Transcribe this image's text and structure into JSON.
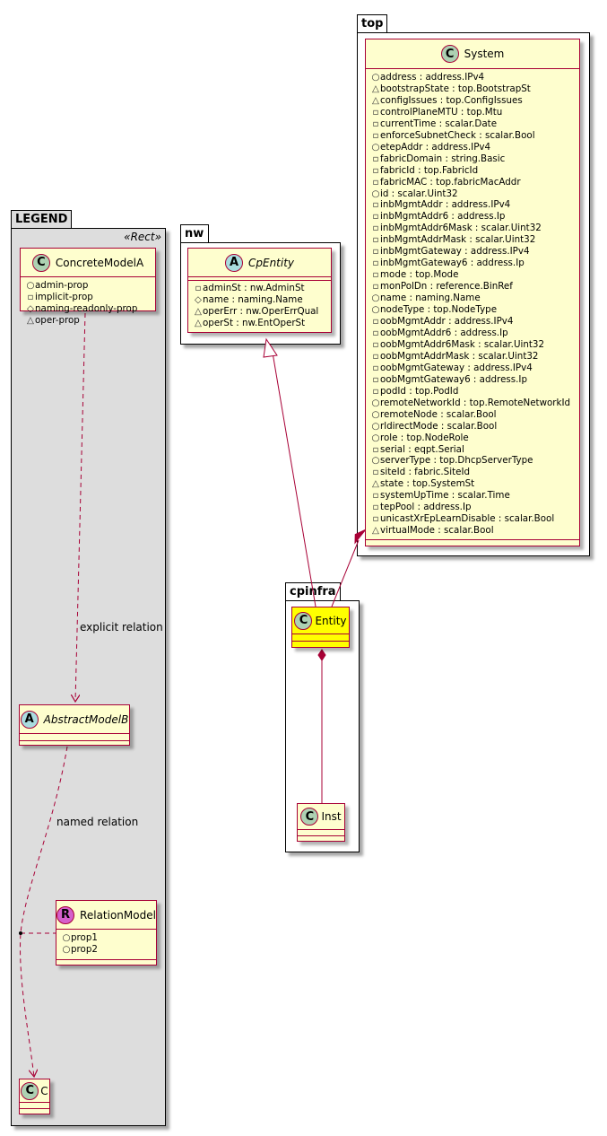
{
  "packages": {
    "legend": {
      "name": "LEGEND",
      "stereotype": "«Rect»"
    },
    "nw": {
      "name": "nw"
    },
    "top": {
      "name": "top"
    },
    "cpinfra": {
      "name": "cpinfra"
    }
  },
  "classes": {
    "concrete_model_a": {
      "kind": "C",
      "name": "ConcreteModelA",
      "attrs": [
        {
          "vis": "○",
          "text": "admin-prop"
        },
        {
          "vis": "▫",
          "text": "implicit-prop"
        },
        {
          "vis": "◇",
          "text": "naming-readonly-prop"
        },
        {
          "vis": "△",
          "text": "oper-prop"
        }
      ]
    },
    "abstract_model_b": {
      "kind": "A",
      "name": "AbstractModelB"
    },
    "relation_model": {
      "kind": "R",
      "name": "RelationModel",
      "attrs": [
        {
          "vis": "○",
          "text": "prop1"
        },
        {
          "vis": "○",
          "text": "prop2"
        }
      ]
    },
    "c": {
      "kind": "C",
      "name": "C"
    },
    "cp_entity": {
      "kind": "A",
      "name": "CpEntity",
      "attrs": [
        {
          "vis": "▫",
          "text": "adminSt : nw.AdminSt"
        },
        {
          "vis": "◇",
          "text": "name : naming.Name"
        },
        {
          "vis": "△",
          "text": "operErr : nw.OperErrQual"
        },
        {
          "vis": "△",
          "text": "operSt : nw.EntOperSt"
        }
      ]
    },
    "system": {
      "kind": "C",
      "name": "System",
      "attrs": [
        {
          "vis": "○",
          "text": "address : address.IPv4"
        },
        {
          "vis": "△",
          "text": "bootstrapState : top.BootstrapSt"
        },
        {
          "vis": "△",
          "text": "configIssues : top.ConfigIssues"
        },
        {
          "vis": "▫",
          "text": "controlPlaneMTU : top.Mtu"
        },
        {
          "vis": "▫",
          "text": "currentTime : scalar.Date"
        },
        {
          "vis": "▫",
          "text": "enforceSubnetCheck : scalar.Bool"
        },
        {
          "vis": "○",
          "text": "etepAddr : address.IPv4"
        },
        {
          "vis": "▫",
          "text": "fabricDomain : string.Basic"
        },
        {
          "vis": "▫",
          "text": "fabricId : top.FabricId"
        },
        {
          "vis": "▫",
          "text": "fabricMAC : top.fabricMacAddr"
        },
        {
          "vis": "○",
          "text": "id : scalar.Uint32"
        },
        {
          "vis": "▫",
          "text": "inbMgmtAddr : address.IPv4"
        },
        {
          "vis": "▫",
          "text": "inbMgmtAddr6 : address.Ip"
        },
        {
          "vis": "▫",
          "text": "inbMgmtAddr6Mask : scalar.Uint32"
        },
        {
          "vis": "▫",
          "text": "inbMgmtAddrMask : scalar.Uint32"
        },
        {
          "vis": "▫",
          "text": "inbMgmtGateway : address.IPv4"
        },
        {
          "vis": "▫",
          "text": "inbMgmtGateway6 : address.Ip"
        },
        {
          "vis": "▫",
          "text": "mode : top.Mode"
        },
        {
          "vis": "▫",
          "text": "monPolDn : reference.BinRef"
        },
        {
          "vis": "○",
          "text": "name : naming.Name"
        },
        {
          "vis": "○",
          "text": "nodeType : top.NodeType"
        },
        {
          "vis": "▫",
          "text": "oobMgmtAddr : address.IPv4"
        },
        {
          "vis": "▫",
          "text": "oobMgmtAddr6 : address.Ip"
        },
        {
          "vis": "▫",
          "text": "oobMgmtAddr6Mask : scalar.Uint32"
        },
        {
          "vis": "▫",
          "text": "oobMgmtAddrMask : scalar.Uint32"
        },
        {
          "vis": "▫",
          "text": "oobMgmtGateway : address.IPv4"
        },
        {
          "vis": "▫",
          "text": "oobMgmtGateway6 : address.Ip"
        },
        {
          "vis": "▫",
          "text": "podId : top.PodId"
        },
        {
          "vis": "○",
          "text": "remoteNetworkId : top.RemoteNetworkId"
        },
        {
          "vis": "○",
          "text": "remoteNode : scalar.Bool"
        },
        {
          "vis": "○",
          "text": "rldirectMode : scalar.Bool"
        },
        {
          "vis": "○",
          "text": "role : top.NodeRole"
        },
        {
          "vis": "▫",
          "text": "serial : eqpt.Serial"
        },
        {
          "vis": "○",
          "text": "serverType : top.DhcpServerType"
        },
        {
          "vis": "▫",
          "text": "siteId : fabric.SiteId"
        },
        {
          "vis": "△",
          "text": "state : top.SystemSt"
        },
        {
          "vis": "▫",
          "text": "systemUpTime : scalar.Time"
        },
        {
          "vis": "▫",
          "text": "tepPool : address.Ip"
        },
        {
          "vis": "▫",
          "text": "unicastXrEpLearnDisable : scalar.Bool"
        },
        {
          "vis": "△",
          "text": "virtualMode : scalar.Bool"
        }
      ]
    },
    "entity": {
      "kind": "C",
      "name": "Entity",
      "fill": "#FFFF00"
    },
    "inst": {
      "kind": "C",
      "name": "Inst"
    }
  },
  "relations": {
    "explicit_label": "explicit relation",
    "named_label": "named relation"
  },
  "colors": {
    "class_fill": "#FEFECE",
    "class_border": "#A80036",
    "legend_fill": "#DDDDDD",
    "highlight_fill": "#FFFF00"
  }
}
